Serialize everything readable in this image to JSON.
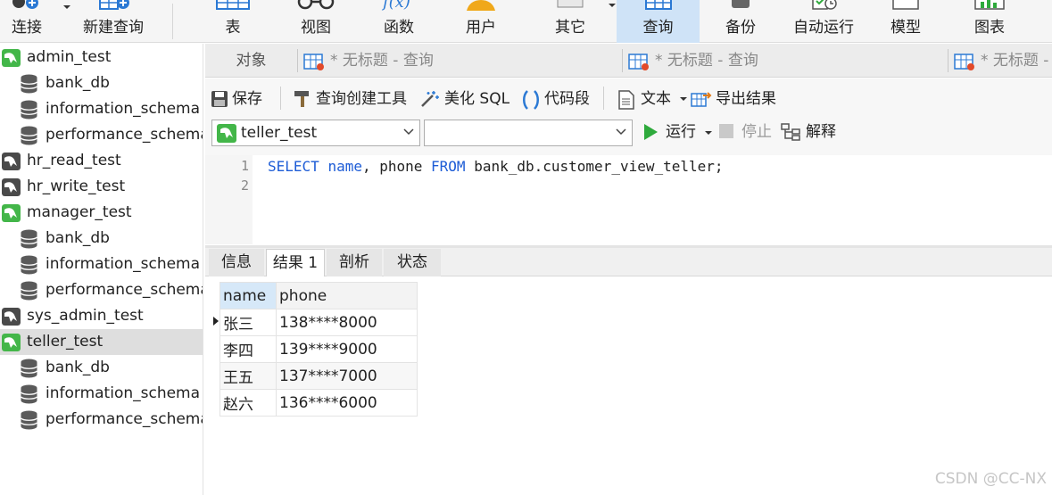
{
  "toolbar": {
    "connect": "连接",
    "new_query": "新建查询",
    "table": "表",
    "view": "视图",
    "function": "函数",
    "user": "用户",
    "other": "其它",
    "query": "查询",
    "backup": "备份",
    "auto_run": "自动运行",
    "model": "模型",
    "chart": "图表"
  },
  "sidebar": {
    "items": [
      {
        "label": "admin_test",
        "type": "connection",
        "status": "open"
      },
      {
        "label": "bank_db",
        "type": "database"
      },
      {
        "label": "information_schema",
        "type": "database"
      },
      {
        "label": "performance_schema",
        "type": "database"
      },
      {
        "label": "hr_read_test",
        "type": "connection",
        "status": "closed"
      },
      {
        "label": "hr_write_test",
        "type": "connection",
        "status": "closed"
      },
      {
        "label": "manager_test",
        "type": "connection",
        "status": "open"
      },
      {
        "label": "bank_db",
        "type": "database"
      },
      {
        "label": "information_schema",
        "type": "database"
      },
      {
        "label": "performance_schema",
        "type": "database"
      },
      {
        "label": "sys_admin_test",
        "type": "connection",
        "status": "closed"
      },
      {
        "label": "teller_test",
        "type": "connection",
        "status": "open",
        "selected": true
      },
      {
        "label": "bank_db",
        "type": "database"
      },
      {
        "label": "information_schema",
        "type": "database"
      },
      {
        "label": "performance_schema",
        "type": "database"
      }
    ]
  },
  "tabs": {
    "objects": "对象",
    "query_tabs": [
      "* 无标题 - 查询",
      "* 无标题 - 查询",
      "* 无标题 - 查询"
    ]
  },
  "query_toolbar": {
    "save": "保存",
    "query_builder": "查询创建工具",
    "beautify": "美化 SQL",
    "snippet": "代码段",
    "text": "文本",
    "export": "导出结果"
  },
  "selectors": {
    "connection": "teller_test",
    "database": "",
    "run": "运行",
    "stop": "停止",
    "explain": "解释"
  },
  "editor": {
    "line_numbers": [
      "1",
      "2"
    ],
    "tokens": [
      {
        "text": "SELECT",
        "kw": true
      },
      {
        "text": " ",
        "kw": false
      },
      {
        "text": "name",
        "kw": true
      },
      {
        "text": ", phone ",
        "kw": false
      },
      {
        "text": "FROM",
        "kw": true
      },
      {
        "text": " bank_db.customer_view_teller;",
        "kw": false
      }
    ]
  },
  "result_tabs": [
    "信息",
    "结果 1",
    "剖析",
    "状态"
  ],
  "active_result_tab": 1,
  "grid": {
    "columns": [
      "name",
      "phone"
    ],
    "rows": [
      [
        "张三",
        "138****8000"
      ],
      [
        "李四",
        "139****9000"
      ],
      [
        "王五",
        "137****7000"
      ],
      [
        "赵六",
        "136****6000"
      ]
    ]
  },
  "watermark": "CSDN @CC-NX",
  "colors": {
    "conn_open": "#43b649",
    "conn_closed": "#4a4a4a",
    "db_icon": "#5a5a5a",
    "active_tab": "#cfe3f7",
    "keyword": "#1d5cd6",
    "run_green": "#2eaa3c"
  }
}
